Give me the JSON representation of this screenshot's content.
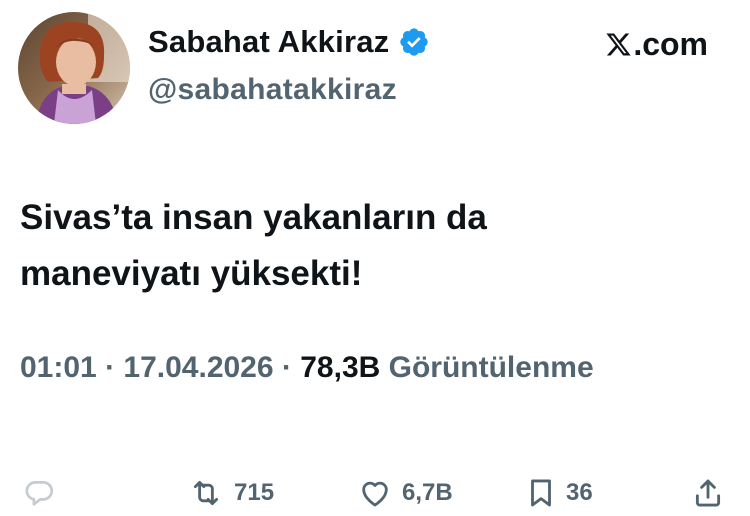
{
  "author": {
    "name": "Sabahat Akkiraz",
    "handle": "@sabahatakkiraz",
    "verified": true
  },
  "brand": {
    "label": ".com",
    "icon": "x-logo-icon"
  },
  "tweet": {
    "lines": [
      "Sivas’ta insan yakanların da",
      "maneviyatı yüksekti!"
    ]
  },
  "meta": {
    "time": "01:01",
    "separator1": " · ",
    "date": "17.04.2026",
    "separator2": " · ",
    "views": "78,3B",
    "views_label": " Görüntülenme"
  },
  "actions": {
    "reply": {
      "icon": "reply-icon",
      "count": ""
    },
    "retweet": {
      "icon": "retweet-icon",
      "count": "715"
    },
    "like": {
      "icon": "heart-icon",
      "count": "6,7B"
    },
    "bookmark": {
      "icon": "bookmark-icon",
      "count": "36"
    },
    "share": {
      "icon": "share-icon",
      "count": ""
    }
  },
  "colors": {
    "text": "#0f1419",
    "secondary": "#536471",
    "verified": "#1d9bf0",
    "reply_icon": "#c4ccd3"
  }
}
